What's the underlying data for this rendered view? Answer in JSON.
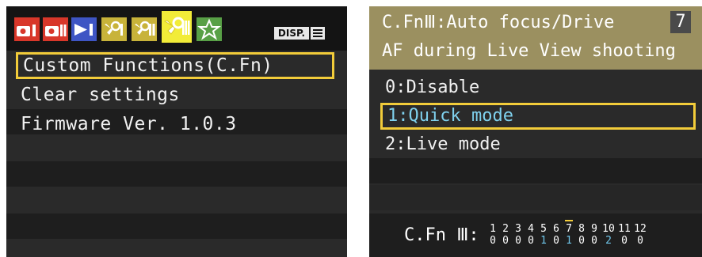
{
  "left_screen": {
    "tabs": [
      {
        "icon": "shooting-menu-1-icon",
        "color": "#d8372a"
      },
      {
        "icon": "shooting-menu-2-icon",
        "color": "#d8372a"
      },
      {
        "icon": "playback-menu-icon",
        "color": "#3e55c4"
      },
      {
        "icon": "setup-menu-1-icon",
        "color": "#c8b33a"
      },
      {
        "icon": "setup-menu-2-icon",
        "color": "#c8b33a"
      },
      {
        "icon": "setup-menu-3-icon",
        "color": "#f2ec38",
        "active": true
      },
      {
        "icon": "my-menu-icon",
        "color": "#58a046"
      }
    ],
    "disp_label": "DISP.",
    "items": [
      {
        "label": "Custom Functions(C.Fn)",
        "selected": true
      },
      {
        "label": "Clear settings"
      },
      {
        "label": "Firmware Ver. 1.0.3"
      }
    ]
  },
  "right_screen": {
    "header": {
      "group": "C.FnⅢ:Auto focus/Drive",
      "number": "7",
      "title": "AF during Live View shooting"
    },
    "options": [
      {
        "label": "0:Disable"
      },
      {
        "label": "1:Quick mode",
        "selected": true
      },
      {
        "label": "2:Live mode"
      }
    ],
    "footer": {
      "label": "C.Fn Ⅲ:",
      "functions": [
        {
          "n": "1",
          "v": "0"
        },
        {
          "n": "2",
          "v": "0"
        },
        {
          "n": "3",
          "v": "0"
        },
        {
          "n": "4",
          "v": "0"
        },
        {
          "n": "5",
          "v": "1"
        },
        {
          "n": "6",
          "v": "0"
        },
        {
          "n": "7",
          "v": "1",
          "current": true
        },
        {
          "n": "8",
          "v": "0"
        },
        {
          "n": "9",
          "v": "0"
        },
        {
          "n": "10",
          "v": "2"
        },
        {
          "n": "11",
          "v": "0"
        },
        {
          "n": "12",
          "v": "0"
        }
      ]
    }
  },
  "colors": {
    "highlight": "#f2cc3a",
    "selected_text": "#7fd1ee",
    "header_bg": "#9b9060"
  }
}
